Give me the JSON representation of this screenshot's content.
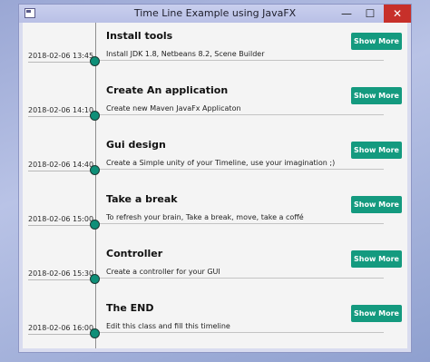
{
  "window": {
    "title": "Time Line Example using JavaFX",
    "min_glyph": "—",
    "max_glyph": "☐",
    "close_glyph": "✕"
  },
  "colors": {
    "accent": "#149a7f",
    "dot": "#0e8f78",
    "close": "#c7302a"
  },
  "entries": [
    {
      "title": "Install tools",
      "description": "Install JDK 1.8, Netbeans 8.2, Scene Builder",
      "date": "2018-02-06 13:45",
      "button": "Show More"
    },
    {
      "title": "Create An application",
      "description": "Create new Maven JavaFx Applicaton",
      "date": "2018-02-06 14:10",
      "button": "Show More"
    },
    {
      "title": "Gui design",
      "description": "Create a Simple unity of your Timeline, use your imagination ;)",
      "date": "2018-02-06 14:40",
      "button": "Show More"
    },
    {
      "title": "Take a break",
      "description": "To refresh your brain, Take a break, move, take a coffé",
      "date": "2018-02-06 15:00",
      "button": "Show More"
    },
    {
      "title": "Controller",
      "description": "Create a controller for your GUI",
      "date": "2018-02-06 15:30",
      "button": "Show More"
    },
    {
      "title": "The END",
      "description": "Edit this class and fill this timeline",
      "date": "2018-02-06 16:00",
      "button": "Show More"
    }
  ]
}
